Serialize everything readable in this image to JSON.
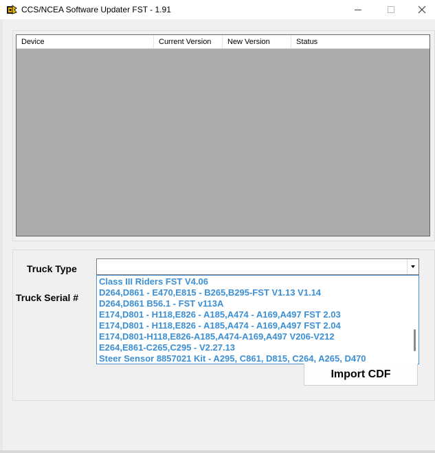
{
  "window": {
    "title": "CCS/NCEA Software Updater FST - 1.91",
    "icon": "app-logo-icon",
    "controls": [
      "minimize",
      "maximize",
      "close"
    ]
  },
  "listview": {
    "columns": [
      "Device",
      "Current Version",
      "New Version",
      "Status"
    ]
  },
  "form": {
    "truck_type_label": "Truck Type",
    "truck_serial_label": "Truck Serial #",
    "truck_type_value": "",
    "dropdown_items": [
      "Class III Riders FST V4.06",
      "D264,D861 - E470,E815 - B265,B295-FST V1.13 V1.14",
      "D264,D861 B56.1 - FST v113A",
      "E174,D801 - H118,E826 - A185,A474 - A169,A497 FST 2.03",
      "E174,D801 - H118,E826 - A185,A474 - A169,A497 FST 2.04",
      "E174,D801-H118,E826-A185,A474-A169,A497 V206-V212",
      "E264,E861-C265,C295 - V2.27.13",
      "Steer Sensor 8857021 Kit - A295, C861, D815, C264, A265, D470"
    ],
    "import_button": "Import CDF"
  },
  "colors": {
    "dropdown_text": "#3b8fd4",
    "dropdown_border": "#4a90d9",
    "listview_bg": "#ababab"
  }
}
